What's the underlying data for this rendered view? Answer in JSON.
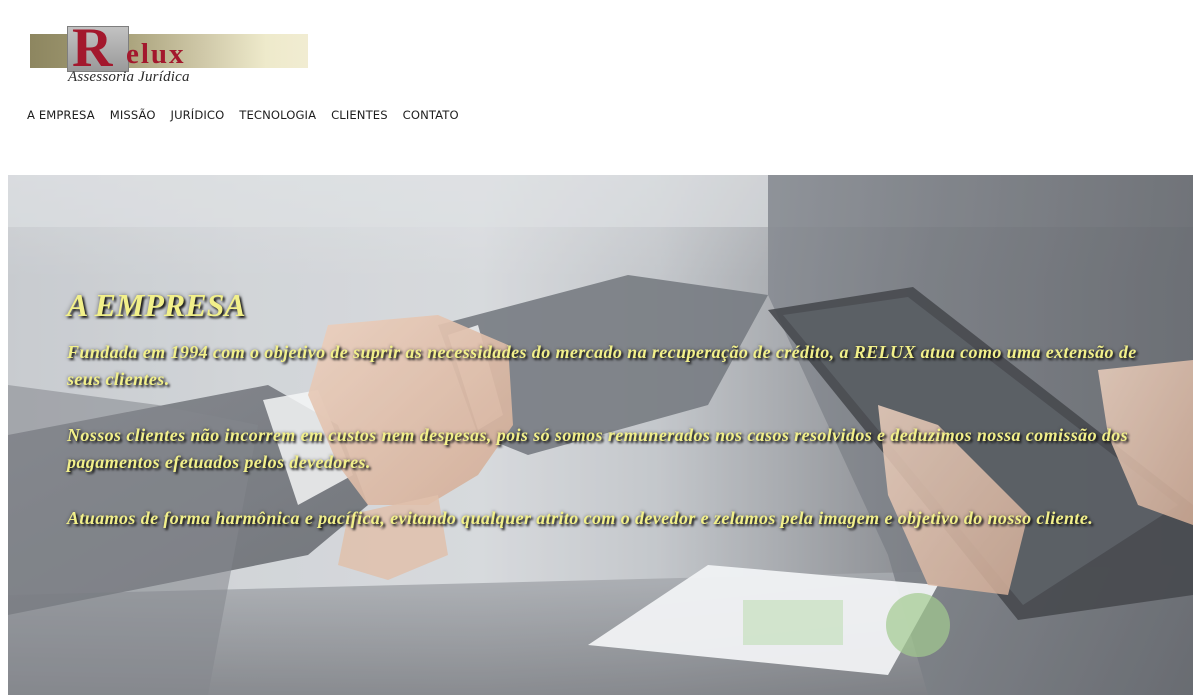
{
  "logo": {
    "letter": "R",
    "word": "elux",
    "tagline": "Assessoria Jurídica",
    "colors": {
      "brand_red": "#a3182d",
      "band_gold": "#a39c74"
    }
  },
  "nav": {
    "items": [
      {
        "label": "A EMPRESA"
      },
      {
        "label": "MISSÃO"
      },
      {
        "label": "JURÍDICO"
      },
      {
        "label": "TECNOLOGIA"
      },
      {
        "label": "CLIENTES"
      },
      {
        "label": "CONTATO"
      }
    ]
  },
  "hero": {
    "title": "A EMPRESA",
    "paragraphs": [
      "Fundada em 1994 com o objetivo de suprir as necessidades do mercado na recuperação de crédito, a RELUX atua como uma extensão de seus clientes.",
      "Nossos clientes não incorrem em custos nem despesas, pois só somos remunerados nos casos resolvidos e deduzimos nossa comissão dos pagamentos efetuados pelos devedores.",
      "Atuamos de forma harmônica e pacífica, evitando qualquer atrito com o devedor e zelamos pela imagem e objetivo do nosso cliente."
    ],
    "text_color": "#f2f08a",
    "background_image": "handshake-over-laptop-photo"
  }
}
